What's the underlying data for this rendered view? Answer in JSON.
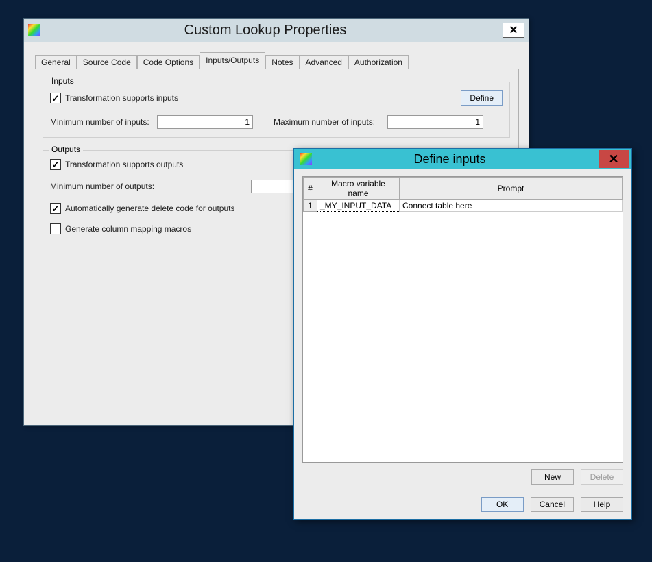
{
  "main": {
    "title": "Custom Lookup Properties",
    "tabs": {
      "general": "General",
      "source_code": "Source Code",
      "code_options": "Code Options",
      "inputs_outputs": "Inputs/Outputs",
      "notes": "Notes",
      "advanced": "Advanced",
      "authorization": "Authorization"
    },
    "inputs_group": {
      "title": "Inputs",
      "supports_label": "Transformation supports inputs",
      "min_label": "Minimum number of inputs:",
      "min_value": "1",
      "max_label": "Maximum number of inputs:",
      "max_value": "1",
      "define_btn": "Define"
    },
    "outputs_group": {
      "title": "Outputs",
      "supports_label": "Transformation supports outputs",
      "min_label": "Minimum number of outputs:",
      "min_value": "",
      "auto_delete_label": "Automatically generate delete code for outputs",
      "gen_mapping_label": "Generate column mapping macros"
    }
  },
  "modal": {
    "title": "Define inputs",
    "columns": {
      "num": "#",
      "varname": "Macro variable name",
      "prompt": "Prompt"
    },
    "rows": [
      {
        "num": "1",
        "varname": "_MY_INPUT_DATA",
        "prompt": "Connect table here"
      }
    ],
    "buttons": {
      "new": "New",
      "delete": "Delete",
      "ok": "OK",
      "cancel": "Cancel",
      "help": "Help"
    }
  }
}
